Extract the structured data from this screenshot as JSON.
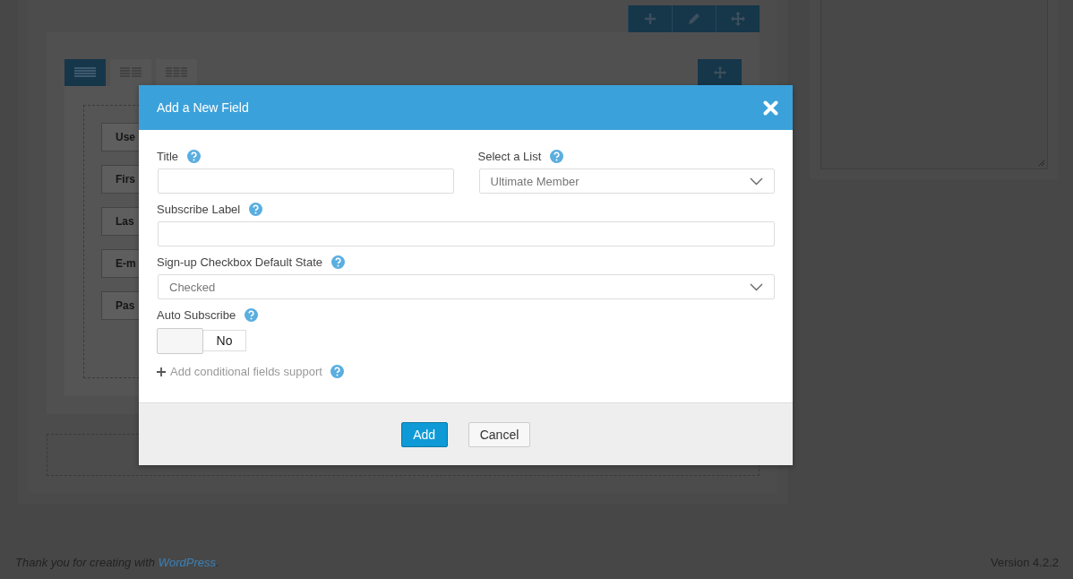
{
  "builder": {
    "layout_tabs": [
      {
        "selected": true
      },
      {
        "selected": false
      },
      {
        "selected": false
      }
    ],
    "field_chips": [
      "Use",
      "Firs",
      "Las",
      "E-m",
      "Pas"
    ]
  },
  "dialog": {
    "title": "Add a New Field",
    "rows": [
      [
        {
          "kind": "text",
          "label": "Title"
        },
        {
          "kind": "select",
          "label": "Select a List",
          "value": "Ultimate Member"
        }
      ],
      [
        {
          "kind": "text",
          "label": "Subscribe Label"
        }
      ],
      [
        {
          "kind": "select",
          "label": "Sign-up Checkbox Default State",
          "value": "Checked"
        }
      ],
      [
        {
          "kind": "toggle",
          "label": "Auto Subscribe",
          "on": false,
          "state_text": "No"
        }
      ]
    ],
    "conditional_link": "Add conditional fields support",
    "buttons": [
      {
        "label": "Add",
        "primary": true
      },
      {
        "label": "Cancel",
        "primary": false
      }
    ]
  },
  "footer": {
    "thanks": "Thank you for creating with",
    "link": "WordPress",
    "end": ".",
    "version": "Version 4.2.2"
  }
}
